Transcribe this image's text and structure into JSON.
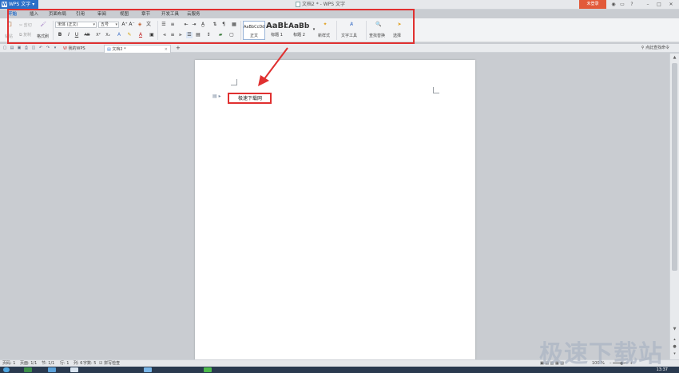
{
  "app": {
    "menu_label": "WPS 文字",
    "logo_char": "W",
    "window_title": "文档2 * - WPS 文字",
    "login_label": "未登录",
    "controls": [
      "◉",
      "▭",
      "?",
      "–",
      "□",
      "✕"
    ]
  },
  "tabs": [
    {
      "label": "开始",
      "active": true
    },
    {
      "label": "插入"
    },
    {
      "label": "页面布局"
    },
    {
      "label": "引用"
    },
    {
      "label": "审阅"
    },
    {
      "label": "视图"
    },
    {
      "label": "章节"
    },
    {
      "label": "开发工具"
    },
    {
      "label": "云服务"
    }
  ],
  "ribbon": {
    "paste_label": "粘贴",
    "cut_label": "剪切",
    "copy_label": "复制",
    "format_painter_label": "格式刷",
    "font_name": "宋体 (正文)",
    "font_size": "五号",
    "bold": "B",
    "italic": "I",
    "underline": "U",
    "strike": "AB",
    "superscript": "X²",
    "subscript": "X₂",
    "styles": [
      {
        "sample": "AaBbCcDd",
        "name": "正文"
      },
      {
        "sample": "AaBb",
        "name": "标题 1"
      },
      {
        "sample": "AaBb(",
        "name": "标题 2"
      }
    ],
    "new_style_label": "新样式",
    "text_tools_label": "文字工具",
    "find_replace_label": "查找替换",
    "select_label": "选择"
  },
  "docbar": {
    "tabs": [
      {
        "label": "我的WPS",
        "active": false
      },
      {
        "label": "文档2 *",
        "active": true
      }
    ],
    "add_tab": "+",
    "find_command": "点此查找命令"
  },
  "document": {
    "text": "极速下载网"
  },
  "status": {
    "page": "页码: 1",
    "pages": "页面: 1/1",
    "section": "节: 1/1",
    "row": "行: 1",
    "col": "列: 6",
    "words": "字数: 5",
    "spell": "拼写检查",
    "zoom": "100 %"
  },
  "taskbar": {
    "clock": "13:37"
  },
  "watermark": "极速下载站",
  "colors": {
    "accent": "#2b6fc7",
    "annotation": "#e03030",
    "login": "#e25a3a"
  }
}
